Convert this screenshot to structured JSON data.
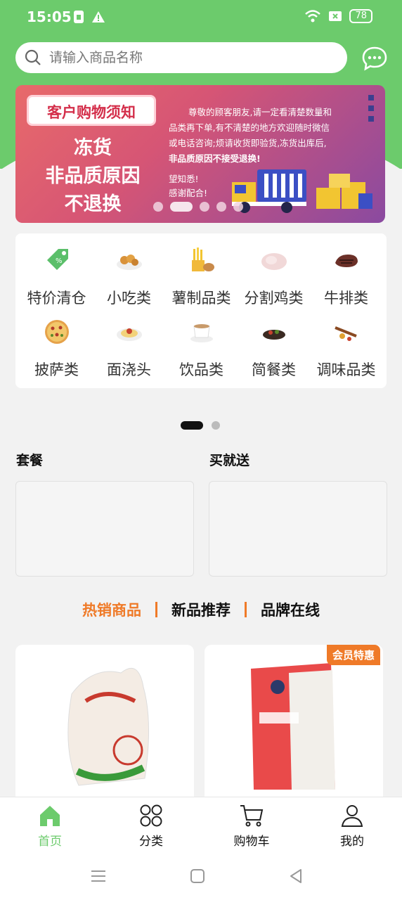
{
  "status": {
    "time": "15:05",
    "battery": "78"
  },
  "search": {
    "placeholder": "请输入商品名称"
  },
  "banner": {
    "tag": "客户购物须知",
    "main_lines": [
      "冻货",
      "非品质原因",
      "不退换"
    ],
    "notice_lines": [
      "尊敬的顾客朋友,请一定看清楚数量和",
      "品类再下单,有不清楚的地方欢迎随时微信",
      "或电话咨询;烦请收货即验货,冻货出库后,",
      "非品质原因不接受退换!"
    ],
    "sign_lines": [
      "望知悉!",
      "感谢配合!"
    ]
  },
  "categories": [
    {
      "label": "特价清仓",
      "icon": "price-tag-icon"
    },
    {
      "label": "小吃类",
      "icon": "snack-bowl-icon"
    },
    {
      "label": "薯制品类",
      "icon": "fries-icon"
    },
    {
      "label": "分割鸡类",
      "icon": "chicken-cut-icon"
    },
    {
      "label": "牛排类",
      "icon": "steak-icon"
    },
    {
      "label": "披萨类",
      "icon": "pizza-icon"
    },
    {
      "label": "面浇头",
      "icon": "noodle-topping-icon"
    },
    {
      "label": "饮品类",
      "icon": "drink-cup-icon"
    },
    {
      "label": "简餐类",
      "icon": "simple-meal-icon"
    },
    {
      "label": "调味品类",
      "icon": "seasoning-icon"
    }
  ],
  "sections": {
    "set_meal": "套餐",
    "buy_gift": "买就送"
  },
  "tabs": [
    {
      "label": "热销商品",
      "active": true
    },
    {
      "label": "新品推荐",
      "active": false
    },
    {
      "label": "品牌在线",
      "active": false
    }
  ],
  "products": [
    {
      "badge": ""
    },
    {
      "badge": "会员特惠"
    }
  ],
  "tabbar": [
    {
      "label": "首页",
      "icon": "home-icon",
      "active": true
    },
    {
      "label": "分类",
      "icon": "category-grid-icon",
      "active": false
    },
    {
      "label": "购物车",
      "icon": "cart-icon",
      "active": false
    },
    {
      "label": "我的",
      "icon": "user-icon",
      "active": false
    }
  ],
  "colors": {
    "brand_green": "#6ccb6c",
    "accent_orange": "#ef7a28"
  }
}
